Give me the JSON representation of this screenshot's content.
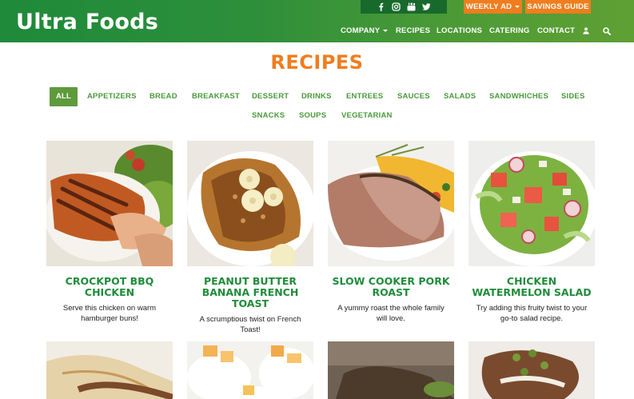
{
  "header": {
    "logo": "Ultra Foods",
    "social_icons": [
      "facebook-icon",
      "instagram-icon",
      "youtube-icon",
      "twitter-icon"
    ],
    "weekly_ad": "WEEKLY AD",
    "savings_guide": "SAVINGS GUIDE",
    "nav": {
      "company": "COMPANY",
      "recipes": "RECIPES",
      "locations": "LOCATIONS",
      "catering": "CATERING",
      "contact": "CONTACT"
    },
    "colors": {
      "green": "#2e8f3a",
      "orange": "#f07d1e"
    }
  },
  "page": {
    "title": "RECIPES"
  },
  "filters": [
    "ALL",
    "APPETIZERS",
    "BREAD",
    "BREAKFAST",
    "DESSERT",
    "DRINKS",
    "ENTREES",
    "SAUCES",
    "SALADS",
    "SANDWHICHES",
    "SIDES",
    "SNACKS",
    "SOUPS",
    "VEGETARIAN"
  ],
  "recipes": [
    {
      "title": "CROCKPOT BBQ CHICKEN",
      "desc": "Serve this chicken on warm hamburger buns!"
    },
    {
      "title": "PEANUT BUTTER BANANA FRENCH TOAST",
      "desc": "A scrumptious twist on French Toast!"
    },
    {
      "title": "SLOW COOKER PORK ROAST",
      "desc": "A yummy roast the whole family will love."
    },
    {
      "title": "CHICKEN WATERMELON SALAD",
      "desc": "Try adding this fruity twist to your go-to salad recipe."
    }
  ]
}
